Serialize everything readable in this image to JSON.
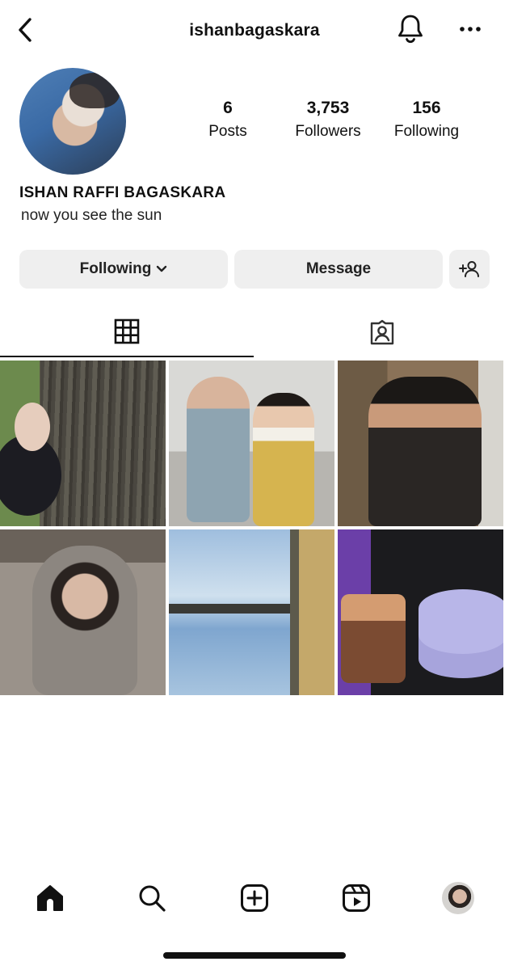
{
  "header": {
    "username": "ishanbagaskara",
    "back_icon": "chevron-left-icon",
    "bell_icon": "bell-icon",
    "more_icon": "more-horizontal-icon"
  },
  "profile": {
    "stats": [
      {
        "value": "6",
        "label": "Posts"
      },
      {
        "value": "3,753",
        "label": "Followers"
      },
      {
        "value": "156",
        "label": "Following"
      }
    ],
    "full_name": "ISHAN RAFFI BAGASKARA",
    "bio": "now you see the sun"
  },
  "actions": {
    "following_label": "Following",
    "message_label": "Message",
    "add_user_icon": "add-user-icon"
  },
  "tabs": [
    {
      "icon": "grid-icon",
      "active": true
    },
    {
      "icon": "tagged-icon",
      "active": false
    }
  ],
  "posts_count_shown": 6,
  "bottom_nav": [
    {
      "icon": "home-icon",
      "active": true
    },
    {
      "icon": "search-icon"
    },
    {
      "icon": "new-post-icon"
    },
    {
      "icon": "reels-icon"
    },
    {
      "icon": "profile-avatar"
    }
  ],
  "colors": {
    "text": "#111111",
    "button_bg": "#efefef"
  }
}
